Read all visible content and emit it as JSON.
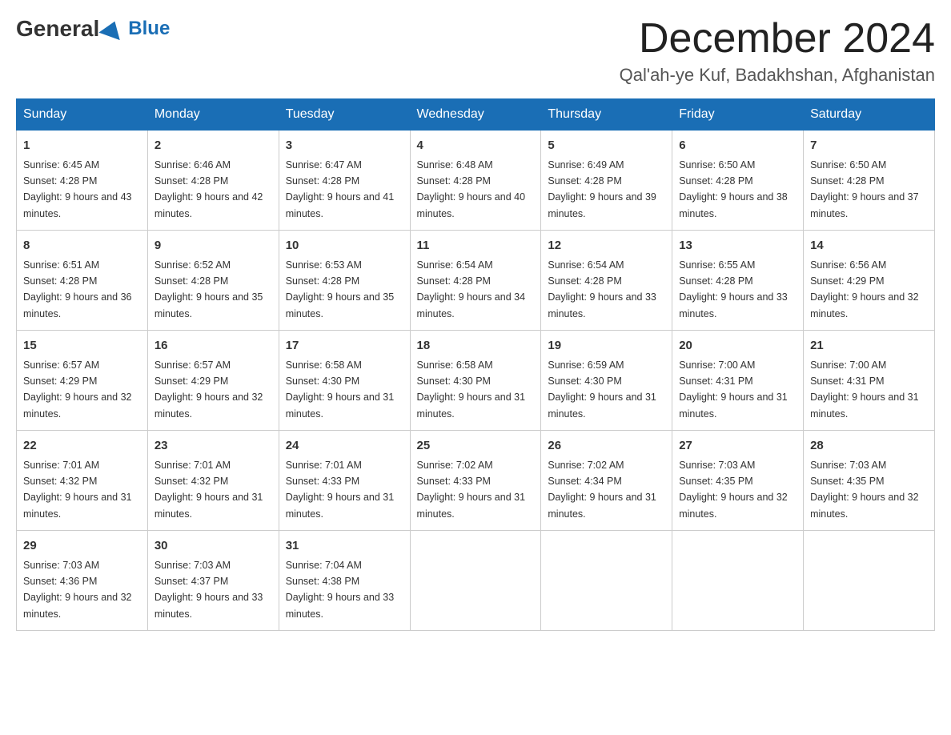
{
  "header": {
    "logo_general": "General",
    "logo_blue": "Blue",
    "month_title": "December 2024",
    "location": "Qal'ah-ye Kuf, Badakhshan, Afghanistan"
  },
  "days_of_week": [
    "Sunday",
    "Monday",
    "Tuesday",
    "Wednesday",
    "Thursday",
    "Friday",
    "Saturday"
  ],
  "weeks": [
    [
      {
        "day": "1",
        "sunrise": "6:45 AM",
        "sunset": "4:28 PM",
        "daylight": "9 hours and 43 minutes."
      },
      {
        "day": "2",
        "sunrise": "6:46 AM",
        "sunset": "4:28 PM",
        "daylight": "9 hours and 42 minutes."
      },
      {
        "day": "3",
        "sunrise": "6:47 AM",
        "sunset": "4:28 PM",
        "daylight": "9 hours and 41 minutes."
      },
      {
        "day": "4",
        "sunrise": "6:48 AM",
        "sunset": "4:28 PM",
        "daylight": "9 hours and 40 minutes."
      },
      {
        "day": "5",
        "sunrise": "6:49 AM",
        "sunset": "4:28 PM",
        "daylight": "9 hours and 39 minutes."
      },
      {
        "day": "6",
        "sunrise": "6:50 AM",
        "sunset": "4:28 PM",
        "daylight": "9 hours and 38 minutes."
      },
      {
        "day": "7",
        "sunrise": "6:50 AM",
        "sunset": "4:28 PM",
        "daylight": "9 hours and 37 minutes."
      }
    ],
    [
      {
        "day": "8",
        "sunrise": "6:51 AM",
        "sunset": "4:28 PM",
        "daylight": "9 hours and 36 minutes."
      },
      {
        "day": "9",
        "sunrise": "6:52 AM",
        "sunset": "4:28 PM",
        "daylight": "9 hours and 35 minutes."
      },
      {
        "day": "10",
        "sunrise": "6:53 AM",
        "sunset": "4:28 PM",
        "daylight": "9 hours and 35 minutes."
      },
      {
        "day": "11",
        "sunrise": "6:54 AM",
        "sunset": "4:28 PM",
        "daylight": "9 hours and 34 minutes."
      },
      {
        "day": "12",
        "sunrise": "6:54 AM",
        "sunset": "4:28 PM",
        "daylight": "9 hours and 33 minutes."
      },
      {
        "day": "13",
        "sunrise": "6:55 AM",
        "sunset": "4:28 PM",
        "daylight": "9 hours and 33 minutes."
      },
      {
        "day": "14",
        "sunrise": "6:56 AM",
        "sunset": "4:29 PM",
        "daylight": "9 hours and 32 minutes."
      }
    ],
    [
      {
        "day": "15",
        "sunrise": "6:57 AM",
        "sunset": "4:29 PM",
        "daylight": "9 hours and 32 minutes."
      },
      {
        "day": "16",
        "sunrise": "6:57 AM",
        "sunset": "4:29 PM",
        "daylight": "9 hours and 32 minutes."
      },
      {
        "day": "17",
        "sunrise": "6:58 AM",
        "sunset": "4:30 PM",
        "daylight": "9 hours and 31 minutes."
      },
      {
        "day": "18",
        "sunrise": "6:58 AM",
        "sunset": "4:30 PM",
        "daylight": "9 hours and 31 minutes."
      },
      {
        "day": "19",
        "sunrise": "6:59 AM",
        "sunset": "4:30 PM",
        "daylight": "9 hours and 31 minutes."
      },
      {
        "day": "20",
        "sunrise": "7:00 AM",
        "sunset": "4:31 PM",
        "daylight": "9 hours and 31 minutes."
      },
      {
        "day": "21",
        "sunrise": "7:00 AM",
        "sunset": "4:31 PM",
        "daylight": "9 hours and 31 minutes."
      }
    ],
    [
      {
        "day": "22",
        "sunrise": "7:01 AM",
        "sunset": "4:32 PM",
        "daylight": "9 hours and 31 minutes."
      },
      {
        "day": "23",
        "sunrise": "7:01 AM",
        "sunset": "4:32 PM",
        "daylight": "9 hours and 31 minutes."
      },
      {
        "day": "24",
        "sunrise": "7:01 AM",
        "sunset": "4:33 PM",
        "daylight": "9 hours and 31 minutes."
      },
      {
        "day": "25",
        "sunrise": "7:02 AM",
        "sunset": "4:33 PM",
        "daylight": "9 hours and 31 minutes."
      },
      {
        "day": "26",
        "sunrise": "7:02 AM",
        "sunset": "4:34 PM",
        "daylight": "9 hours and 31 minutes."
      },
      {
        "day": "27",
        "sunrise": "7:03 AM",
        "sunset": "4:35 PM",
        "daylight": "9 hours and 32 minutes."
      },
      {
        "day": "28",
        "sunrise": "7:03 AM",
        "sunset": "4:35 PM",
        "daylight": "9 hours and 32 minutes."
      }
    ],
    [
      {
        "day": "29",
        "sunrise": "7:03 AM",
        "sunset": "4:36 PM",
        "daylight": "9 hours and 32 minutes."
      },
      {
        "day": "30",
        "sunrise": "7:03 AM",
        "sunset": "4:37 PM",
        "daylight": "9 hours and 33 minutes."
      },
      {
        "day": "31",
        "sunrise": "7:04 AM",
        "sunset": "4:38 PM",
        "daylight": "9 hours and 33 minutes."
      },
      null,
      null,
      null,
      null
    ]
  ]
}
